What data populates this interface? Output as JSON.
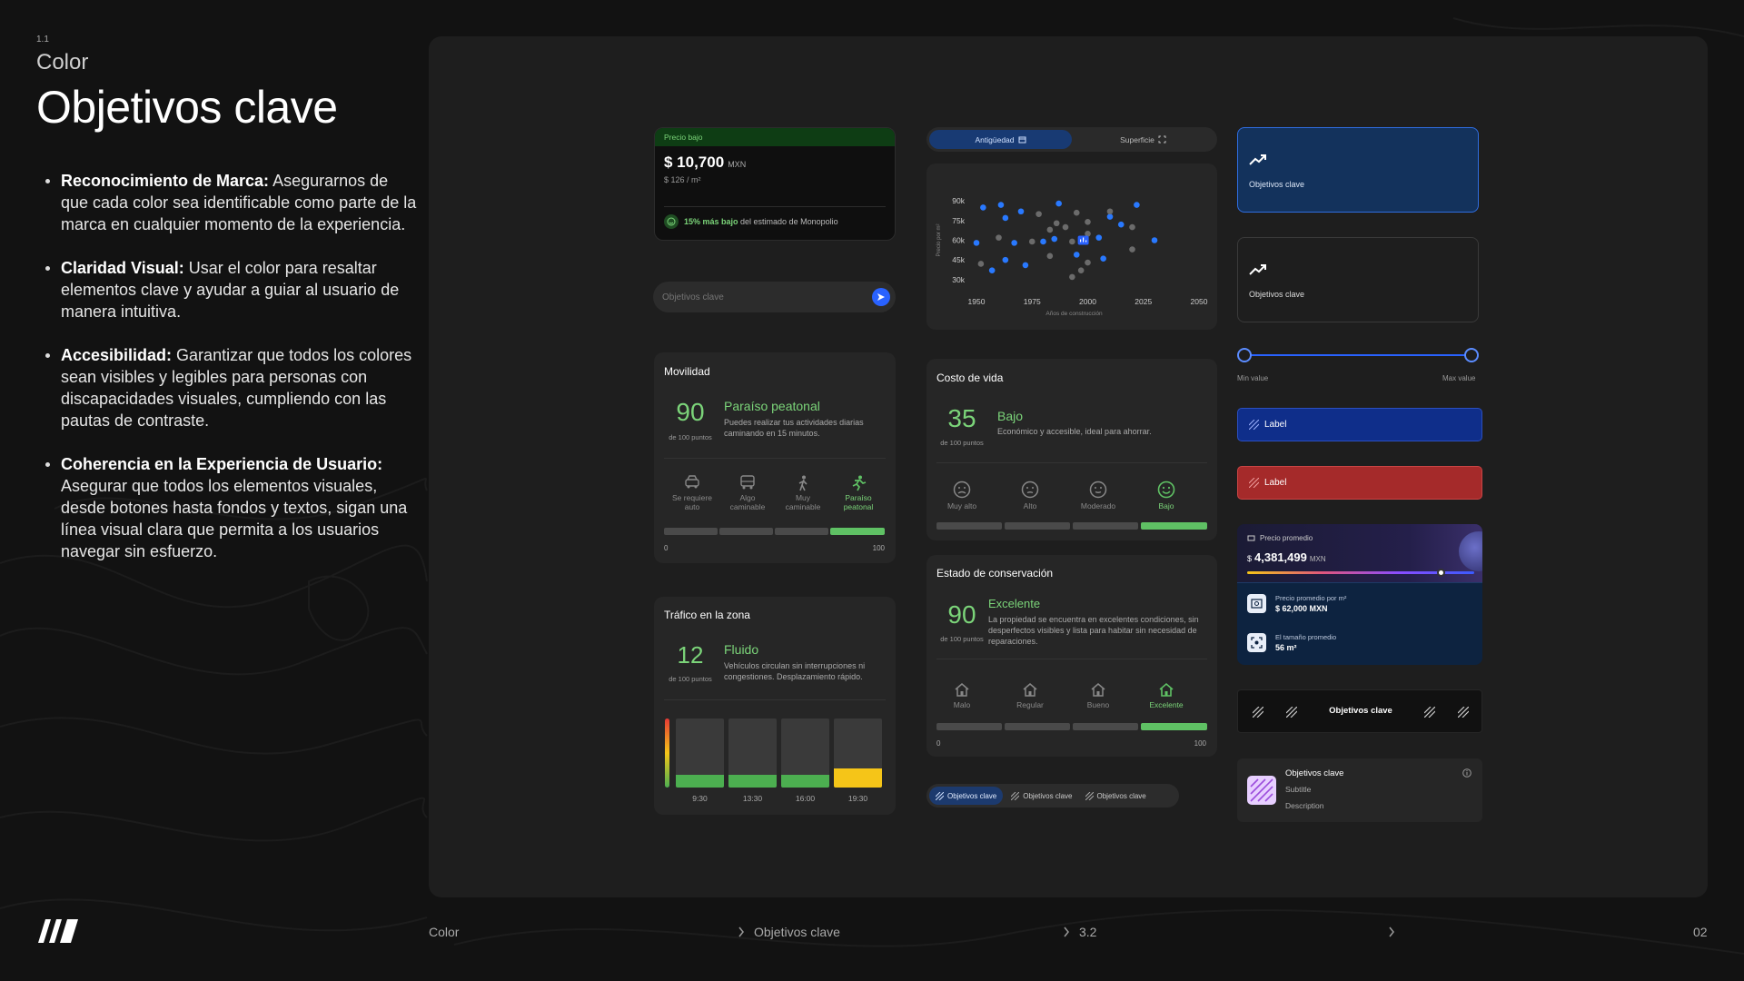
{
  "section": {
    "number": "1.1",
    "label": "Color",
    "title": "Objetivos clave"
  },
  "bullets": [
    {
      "title": "Reconocimiento de Marca:",
      "text": " Asegurarnos de que cada color sea identificable como parte de la marca  en cualquier momento de la experiencia."
    },
    {
      "title": "Claridad Visual:",
      "text": " Usar el color para resaltar elementos clave y ayudar a guiar al usuario de manera intuitiva."
    },
    {
      "title": "Accesibilidad:",
      "text": " Garantizar que todos los colores sean visibles y legibles para personas con discapacidades visuales, cumpliendo con las pautas de contraste."
    },
    {
      "title": "Coherencia en la Experiencia de Usuario:",
      "text": " Asegurar que todos los elementos visuales, desde botones hasta fondos y textos, sigan una línea visual clara que permita a los usuarios navegar sin esfuerzo."
    }
  ],
  "price_card": {
    "tag": "Precio bajo",
    "price": "$ 10,700",
    "currency": "MXN",
    "per_m2": "$ 126 / m²",
    "note_bold": "15% más bajo",
    "note_rest": " del estimado de Monopolio"
  },
  "search": {
    "placeholder": "Objetivos clave"
  },
  "mobility": {
    "title": "Movilidad",
    "score": "90",
    "of": "de 100 puntos",
    "label": "Paraíso peatonal",
    "desc": "Puedes realizar tus actividades diarias caminando en 15 minutos.",
    "level": 4,
    "levels": [
      "Se requiere auto",
      "Algo caminable",
      "Muy caminable",
      "Paraíso peatonal"
    ],
    "min": "0",
    "max": "100"
  },
  "traffic": {
    "title": "Tráfico en la zona",
    "score": "12",
    "of": "de 100 puntos",
    "label": "Fluido",
    "desc": "Vehículos circulan sin interrupciones ni congestiones. Desplazamiento rápido.",
    "times": [
      "9:30",
      "13:30",
      "16:00",
      "19:30"
    ],
    "levels": [
      0.18,
      0.18,
      0.18,
      0.28
    ],
    "colors": [
      "#4caf50",
      "#4caf50",
      "#4caf50",
      "#f5c518"
    ]
  },
  "tabs": {
    "active": "Antigüedad",
    "inactive": "Superficie"
  },
  "scatter": {
    "ylabel": "Precio por m²",
    "xlabel": "Años de construcción",
    "yticks": [
      "90k",
      "75k",
      "60k",
      "45k",
      "30k"
    ],
    "xticks": [
      "1950",
      "1975",
      "2000",
      "2025",
      "2050"
    ],
    "xlim": [
      1950,
      2050
    ],
    "ylim": [
      25000,
      95000
    ],
    "chart_data": {
      "type": "scatter",
      "series": [
        {
          "color": "#2979ff",
          "points": [
            [
              1953,
              85000
            ],
            [
              1961,
              87000
            ],
            [
              1963,
              77000
            ],
            [
              1970,
              82000
            ],
            [
              1987,
              88000
            ],
            [
              2005,
              62000
            ],
            [
              2010,
              78000
            ],
            [
              2015,
              72000
            ],
            [
              2022,
              87000
            ],
            [
              2030,
              60000
            ],
            [
              1950,
              58000
            ],
            [
              1967,
              58000
            ],
            [
              1980,
              59000
            ],
            [
              1985,
              61000
            ],
            [
              1963,
              45000
            ],
            [
              1972,
              41000
            ],
            [
              1995,
              49000
            ],
            [
              1957,
              37000
            ],
            [
              2007,
              46000
            ]
          ]
        },
        {
          "color": "#6b6b6b",
          "points": [
            [
              1978,
              80000
            ],
            [
              1986,
              73000
            ],
            [
              1990,
              70000
            ],
            [
              1995,
              81000
            ],
            [
              2000,
              74000
            ],
            [
              1983,
              68000
            ],
            [
              2000,
              65000
            ],
            [
              2010,
              82000
            ],
            [
              2020,
              70000
            ],
            [
              1960,
              62000
            ],
            [
              1975,
              59000
            ],
            [
              1993,
              59000
            ],
            [
              2000,
              43000
            ],
            [
              2020,
              53000
            ],
            [
              1952,
              42000
            ],
            [
              1983,
              48000
            ],
            [
              1997,
              37000
            ],
            [
              1993,
              32000
            ]
          ]
        }
      ]
    },
    "highlight": {
      "x": 1998,
      "y": 60000
    }
  },
  "cost": {
    "title": "Costo de vida",
    "score": "35",
    "of": "de 100 puntos",
    "label": "Bajo",
    "desc": "Económico y accesible, ideal para ahorrar.",
    "level": 4,
    "levels": [
      "Muy alto",
      "Alto",
      "Moderado",
      "Bajo"
    ]
  },
  "conservation": {
    "title": "Estado de conservación",
    "score": "90",
    "of": "de 100 puntos",
    "label": "Excelente",
    "desc": "La propiedad se encuentra en excelentes condiciones, sin desperfectos visibles y lista para habitar sin necesidad de reparaciones.",
    "level": 4,
    "levels": [
      "Malo",
      "Regular",
      "Bueno",
      "Excelente"
    ],
    "min": "0",
    "max": "100"
  },
  "pills": [
    "Objetivos clave",
    "Objetivos clave",
    "Objetivos clave"
  ],
  "cards": {
    "active_label": "Objetivos clave",
    "inactive_label": "Objetivos clave"
  },
  "range": {
    "min_label": "Min value",
    "max_label": "Max value"
  },
  "label_buttons": {
    "blue": "Label",
    "red": "Label"
  },
  "avg": {
    "title": "Precio promedio",
    "symbol": "$",
    "value": "4,381,499",
    "currency": "MXN",
    "slider_pos": 0.85,
    "rows": [
      {
        "label": "Precio promedio por m²",
        "value": "$ 62,000 MXN",
        "icon": "money-icon"
      },
      {
        "label": "El tamaño promedio",
        "value": "56 m²",
        "icon": "size-icon"
      }
    ]
  },
  "segbar": {
    "label": "Objetivos clave"
  },
  "list_item": {
    "title": "Objetivos clave",
    "subtitle": "Subtitle",
    "description": "Description"
  },
  "footer": {
    "section": "Color",
    "crumb": "Objetivos clave",
    "sub": "3.2",
    "page": "02"
  },
  "colors": {
    "accent_blue": "#1d4ed8",
    "green": "#5fc164",
    "red": "#a52a2a",
    "navy": "#0f2e8a"
  }
}
